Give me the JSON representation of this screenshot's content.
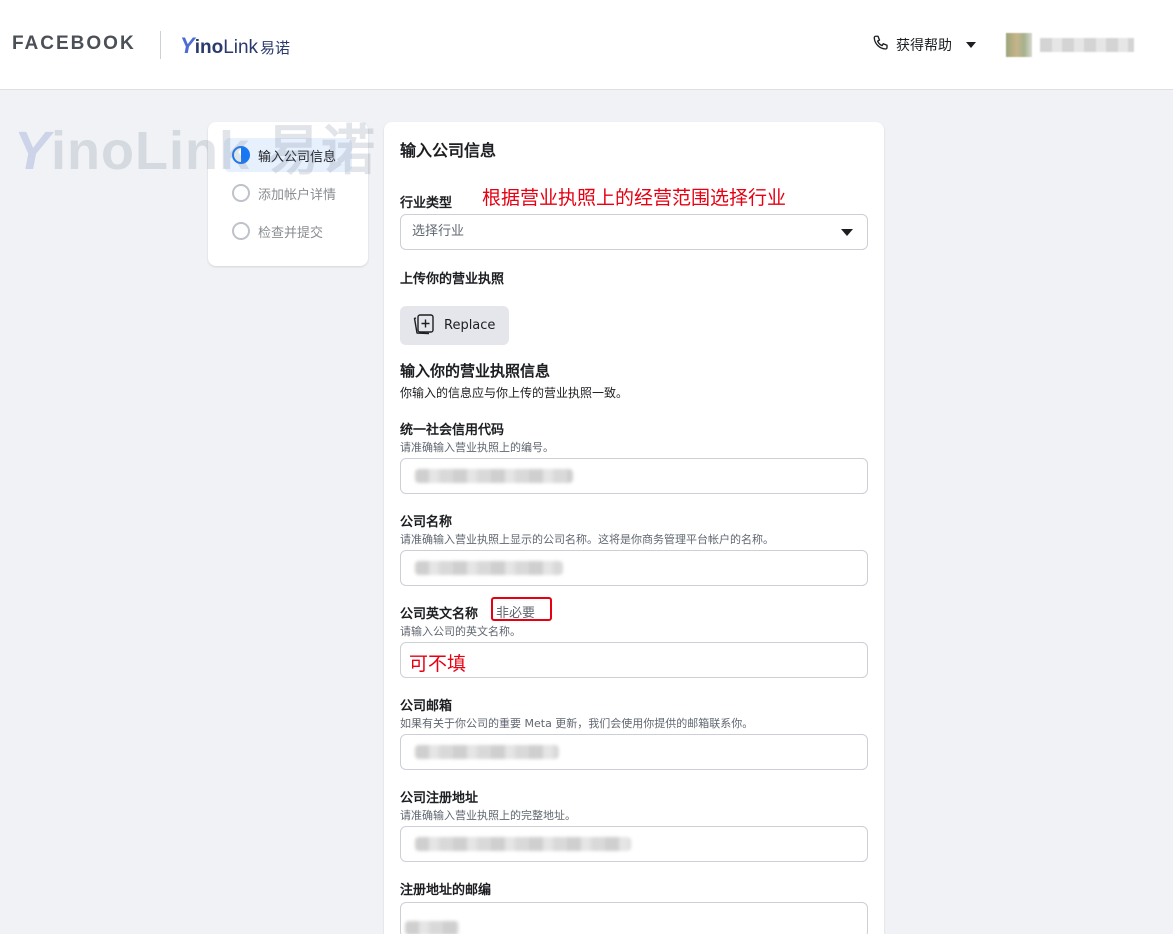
{
  "header": {
    "brand_facebook": "FACEBOOK",
    "brand_yino_y": "Y",
    "brand_yino_ino": "ino",
    "brand_yino_link": "Link",
    "brand_yino_cn": "易诺",
    "help_label": "获得帮助"
  },
  "watermark": {
    "y": "Y",
    "rest": "inoLink 易诺"
  },
  "steps": [
    {
      "label": "输入公司信息",
      "state": "active"
    },
    {
      "label": "添加帐户详情",
      "state": "pending"
    },
    {
      "label": "检查并提交",
      "state": "pending"
    }
  ],
  "form": {
    "title": "输入公司信息",
    "industry": {
      "label": "行业类型",
      "annotation": "根据营业执照上的经营范围选择行业",
      "placeholder": "选择行业"
    },
    "upload": {
      "label": "上传你的营业执照",
      "button_label": "Replace"
    },
    "license_section": {
      "title": "输入你的营业执照信息",
      "subtitle": "你输入的信息应与你上传的营业执照一致。"
    },
    "credit_code": {
      "label": "统一社会信用代码",
      "hint": "请准确输入营业执照上的编号。"
    },
    "company_name": {
      "label": "公司名称",
      "hint": "请准确输入营业执照上显示的公司名称。这将是你商务管理平台帐户的名称。"
    },
    "english_name": {
      "label": "公司英文名称",
      "optional": "非必要",
      "hint": "请输入公司的英文名称。",
      "annotation": "可不填"
    },
    "email": {
      "label": "公司邮箱",
      "hint": "如果有关于你公司的重要 Meta 更新，我们会使用你提供的邮箱联系你。"
    },
    "address": {
      "label": "公司注册地址",
      "hint": "请准确输入营业执照上的完整地址。"
    },
    "postal_code": {
      "label": "注册地址的邮编"
    }
  },
  "colors": {
    "accent": "#1877f2",
    "annotation_red": "#e60012",
    "background": "#f0f2f5"
  },
  "icons": [
    "phone-icon",
    "caret-down-icon",
    "upload-image-icon",
    "step-circle-icon"
  ]
}
